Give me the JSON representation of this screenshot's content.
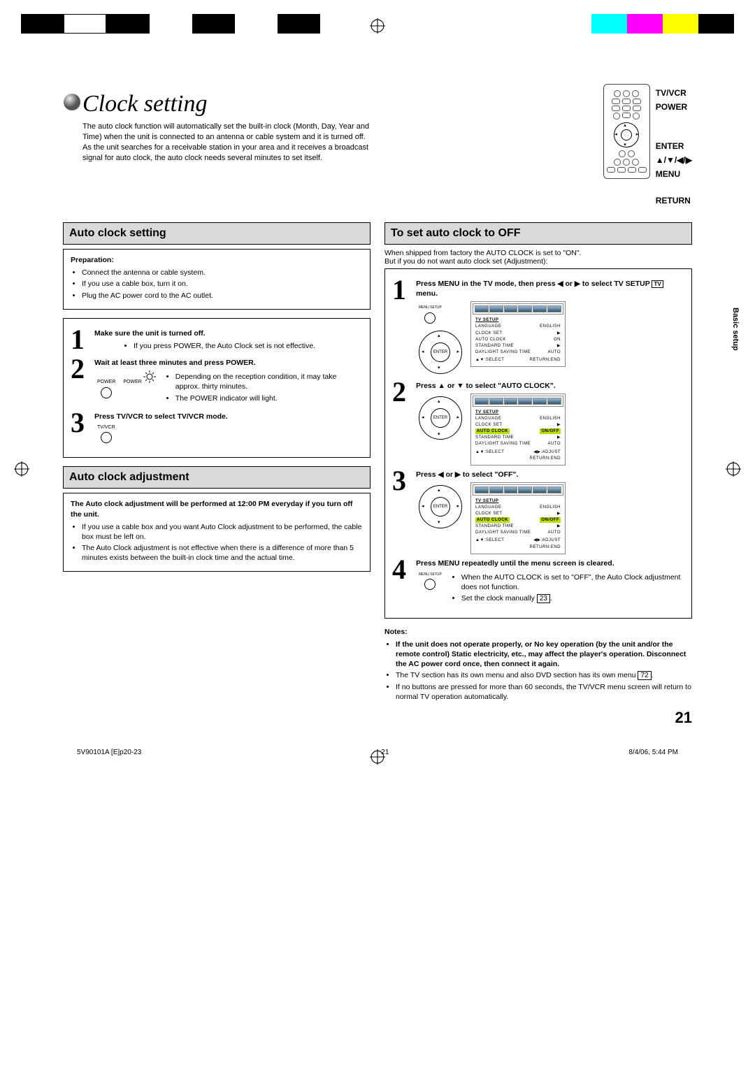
{
  "title": "Clock setting",
  "intro": "The auto clock function will automatically set the built-in clock (Month, Day, Year and Time) when the unit is connected to an antenna or cable system and it is turned off. As the unit searches for a receivable station in your area and it receives a broadcast signal for auto clock, the auto clock needs several minutes to set itself.",
  "remote_labels": {
    "tvvcr": "TV/VCR",
    "power": "POWER",
    "enter": "ENTER",
    "arrows": "▲/▼/◀/▶",
    "menu": "MENU",
    "return": "RETURN"
  },
  "side_tab": "Basic setup",
  "left": {
    "sec1": "Auto clock setting",
    "prep_hd": "Preparation:",
    "prep": [
      "Connect the antenna or cable system.",
      "If you use a cable box, turn it on.",
      "Plug the AC power cord to the AC outlet."
    ],
    "s1_hd": "Make sure the unit is turned off.",
    "s1_li": "If you press POWER, the Auto Clock set is not effective.",
    "s2_hd": "Wait at least three minutes and press POWER.",
    "s2_li1": "Depending on the reception condition, it may take approx. thirty minutes.",
    "s2_li2": "The POWER indicator will light.",
    "s3_hd": "Press TV/VCR to select TV/VCR mode.",
    "btn_power": "POWER",
    "btn_tvvcr": "TV/VCR",
    "sec2": "Auto clock adjustment",
    "adj_hd": "The Auto clock adjustment will be performed at 12:00 PM everyday if you turn off the unit.",
    "adj_li1": "If you use a cable box and you want Auto Clock adjustment to be performed, the cable box must be left on.",
    "adj_li2": "The Auto Clock adjustment is not effective when there is a difference of more than 5 minutes exists between the built-in clock time and the actual time."
  },
  "right": {
    "sec1": "To set auto clock to OFF",
    "lead1": "When shipped from factory the AUTO CLOCK is set to \"ON\".",
    "lead2": "But if you do not want auto clock set (Adjustment):",
    "s1_hd_a": "Press MENU in the TV mode, then press ◀ or ▶ to select TV SETUP",
    "s1_hd_b": "menu.",
    "btn_menu": "MENU SETUP",
    "enter_label": "ENTER",
    "s2_hd": "Press ▲ or ▼ to select \"AUTO CLOCK\".",
    "s3_hd": "Press ◀ or ▶ to select \"OFF\".",
    "s4_hd": "Press MENU repeatedly until the menu screen is cleared.",
    "s4_li1": "When the AUTO CLOCK is set to \"OFF\", the Auto Clock adjustment does not function.",
    "s4_li2_a": "Set the clock manually",
    "s4_ref": "23",
    "notes_hd": "Notes:",
    "n1": "If the unit does not operate properly, or No key operation (by the unit and/or the remote control) Static electricity, etc., may affect the player's operation. Disconnect the AC power cord once, then connect it again.",
    "n2_a": "The TV section has its own menu and also DVD section has its own menu",
    "n2_ref": "72",
    "n3": "If no buttons are pressed for more than 60 seconds, the TV/VCR menu screen will return to normal TV operation automatically.",
    "osd": {
      "title": "TV SETUP",
      "rows": [
        "LANGUAGE",
        "CLOCK SET",
        "AUTO CLOCK",
        "STANDARD TIME",
        "DAYLIGHT SAVING TIME"
      ],
      "vals_on": [
        "ENGLISH",
        "▶",
        "ON/OFF",
        "▶",
        "AUTO"
      ],
      "vals_off": [
        "ENGLISH",
        "▶",
        "ON/OFF",
        "▶",
        "AUTO"
      ],
      "foot_l": "▲▼:SELECT",
      "foot_r1": "RETURN:END",
      "foot_r2": "◀▶:ADJUST"
    }
  },
  "page_number": "21",
  "footer": {
    "left": "5V90101A [E]p20-23",
    "center": "21",
    "right": "8/4/06, 5:44 PM"
  }
}
